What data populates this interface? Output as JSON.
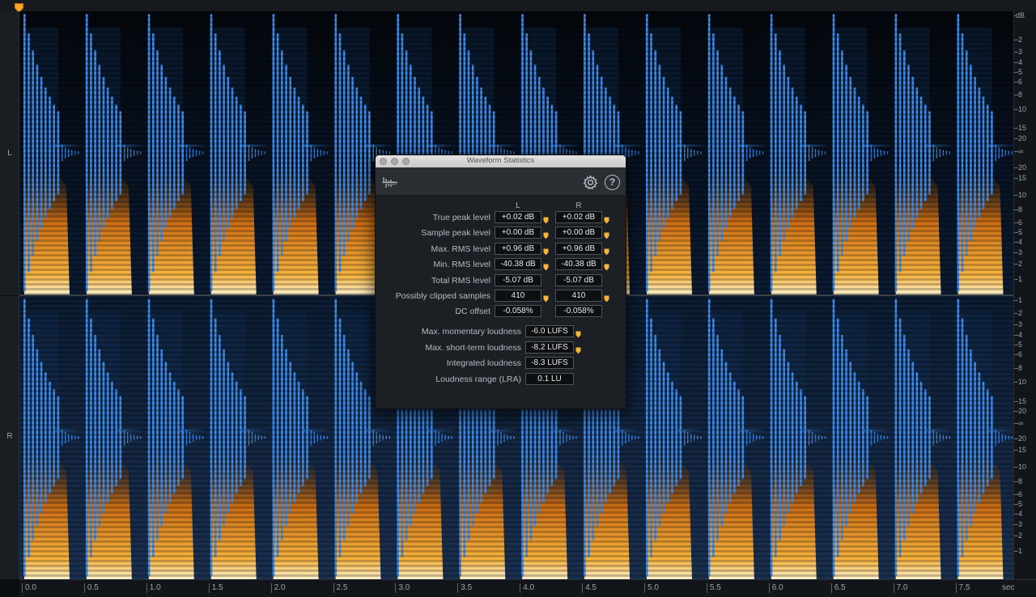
{
  "channels": {
    "left_label": "L",
    "right_label": "R"
  },
  "db_scale": {
    "left": [
      "dB",
      "-2",
      "-3",
      "-4",
      "-5",
      "-6",
      "-8",
      "-10",
      "-15",
      "-20",
      "-∞",
      "-20",
      "-15",
      "-10",
      "-8",
      "-6",
      "-5",
      "-4",
      "-3",
      "-2",
      "-1"
    ],
    "right": [
      "-1",
      "-2",
      "-3",
      "-4",
      "-5",
      "-6",
      "-8",
      "-10",
      "-15",
      "-20",
      "-∞",
      "-20",
      "-15",
      "-10",
      "-8",
      "-6",
      "-5",
      "-4",
      "-3",
      "-2",
      "-1"
    ]
  },
  "time_ruler": {
    "ticks": [
      "0.0",
      "0.5",
      "1.0",
      "1.5",
      "2.0",
      "2.5",
      "3.0",
      "3.5",
      "4.0",
      "4.5",
      "5.0",
      "5.5",
      "6.0",
      "6.5",
      "7.0",
      "7.5"
    ],
    "unit": "sec"
  },
  "dialog": {
    "title": "Waveform Statistics",
    "col_left": "L",
    "col_right": "R",
    "rows": [
      {
        "label": "True peak level",
        "left": "+0.02 dB",
        "right": "+0.02 dB",
        "warn": true
      },
      {
        "label": "Sample peak level",
        "left": "+0.00 dB",
        "right": "+0.00 dB",
        "warn": true
      },
      {
        "label": "Max. RMS level",
        "left": "+0.96 dB",
        "right": "+0.96 dB",
        "warn": true
      },
      {
        "label": "Min. RMS level",
        "left": "-40.38 dB",
        "right": "-40.38 dB",
        "warn": true
      },
      {
        "label": "Total RMS level",
        "left": "-5.07 dB",
        "right": "-5.07 dB",
        "warn": false
      },
      {
        "label": "Possibly clipped samples",
        "left": "410",
        "right": "410",
        "warn": true
      },
      {
        "label": "DC offset",
        "left": "-0.058%",
        "right": "-0.058%",
        "warn": false
      }
    ],
    "loudness": [
      {
        "label": "Max. momentary loudness",
        "value": "-6.0 LUFS",
        "warn": true
      },
      {
        "label": "Max. short-term loudness",
        "value": "-8.2 LUFS",
        "warn": true
      },
      {
        "label": "Integrated loudness",
        "value": "-8.3 LUFS",
        "warn": false
      },
      {
        "label": "Loudness range (LRA)",
        "value": "0.1 LU",
        "warn": false
      }
    ]
  },
  "colors": {
    "waveform": "#3f8ff0",
    "spectrogram_hot": "#f3a52f",
    "warning": "#f5b43a",
    "background": "#0b0e12"
  },
  "icons": {
    "playhead": "playhead-marker-icon",
    "settings": "gear-icon",
    "help": "help-icon",
    "warning": "warning-marker-icon",
    "logo": "waveform-stats-icon"
  }
}
